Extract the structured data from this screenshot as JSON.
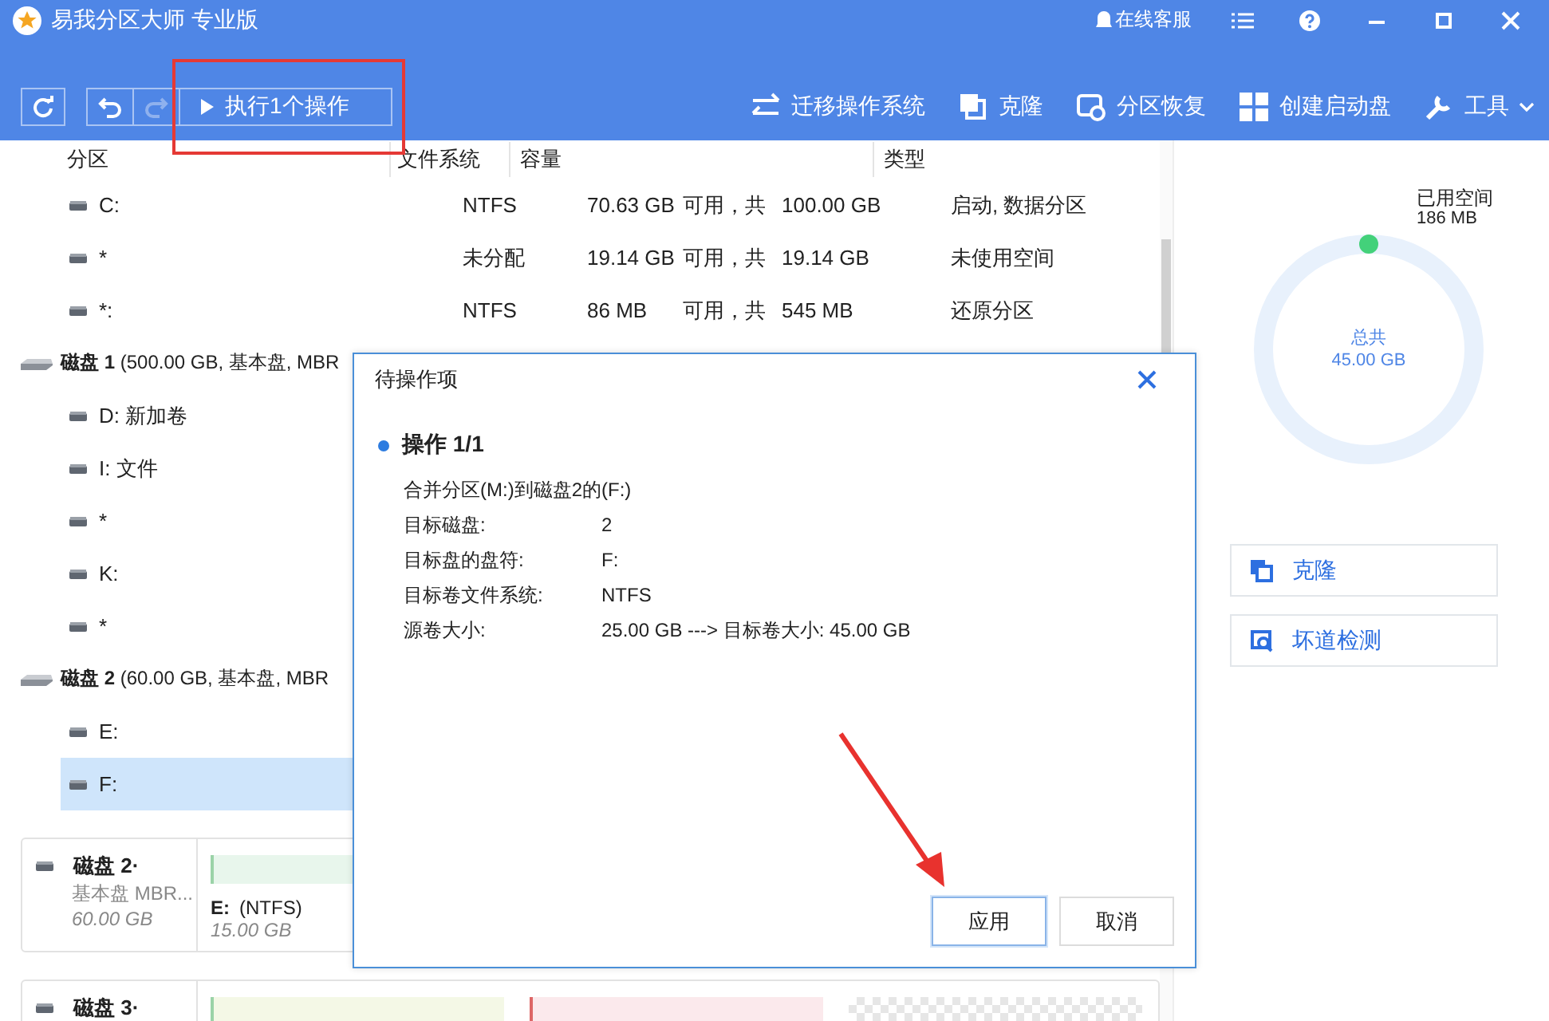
{
  "window": {
    "title": "易我分区大师 专业版",
    "support": "在线客服"
  },
  "toolbar": {
    "execute": "执行1个操作",
    "actions": [
      {
        "kind": "migrate",
        "label": "迁移操作系统"
      },
      {
        "kind": "clone",
        "label": "克隆"
      },
      {
        "kind": "recover",
        "label": "分区恢复"
      },
      {
        "kind": "boot",
        "label": "创建启动盘"
      },
      {
        "kind": "tools",
        "label": "工具",
        "dropdown": true
      }
    ]
  },
  "table": {
    "columns": [
      "分区",
      "文件系统",
      "容量",
      "类型"
    ],
    "rows": [
      {
        "kind": "partition",
        "name": "C:",
        "fs": "NTFS",
        "free": "70.63 GB",
        "mid": "可用，共",
        "total": "100.00 GB",
        "type": "启动, 数据分区",
        "selected": false
      },
      {
        "kind": "partition",
        "name": "*",
        "fs": "未分配",
        "free": "19.14 GB",
        "mid": "可用，共",
        "total": "19.14 GB",
        "type": "未使用空间",
        "selected": false
      },
      {
        "kind": "partition",
        "name": "*:",
        "fs": "NTFS",
        "free": "86 MB",
        "mid": "可用，共",
        "total": "545 MB",
        "type": "还原分区",
        "selected": false
      },
      {
        "kind": "disk",
        "title": "磁盘 1",
        "info": "(500.00 GB, 基本盘, MBR",
        "children": [
          {
            "kind": "partition",
            "name": "D: 新加卷",
            "selected": false
          },
          {
            "kind": "partition",
            "name": "I: 文件",
            "selected": false
          },
          {
            "kind": "partition",
            "name": "*",
            "selected": false
          },
          {
            "kind": "partition",
            "name": "K:",
            "selected": false
          },
          {
            "kind": "partition",
            "name": "*",
            "selected": false
          }
        ]
      },
      {
        "kind": "disk",
        "title": "磁盘 2",
        "info": "(60.00 GB, 基本盘, MBR",
        "children": [
          {
            "kind": "partition",
            "name": "E:",
            "selected": false
          },
          {
            "kind": "partition",
            "name": "F:",
            "selected": true
          }
        ]
      }
    ]
  },
  "disk_map": [
    {
      "title": "磁盘 2·",
      "style": "基本盘 MBR...",
      "size": "60.00 GB",
      "segments": [
        {
          "kind": "partition",
          "color": "#e8f6ec",
          "label": "E:",
          "fs": "(NTFS)",
          "size": "15.00 GB"
        }
      ]
    },
    {
      "title": "磁盘 3·",
      "segments": [
        {
          "kind": "partition",
          "color": "#f4f8e6"
        },
        {
          "kind": "partition",
          "color": "#fbe9ec"
        },
        {
          "kind": "unallocated"
        }
      ]
    }
  ],
  "side_panel": {
    "used_label": "已用空间",
    "used": "186 MB",
    "total_label": "总共",
    "total": "45.00 GB",
    "buttons": [
      {
        "kind": "clone",
        "label": "克隆"
      },
      {
        "kind": "scan",
        "label": "坏道检测"
      }
    ]
  },
  "dialog": {
    "title": "待操作项",
    "operation": "操作 1/1",
    "summary": "合并分区(M:)到磁盘2的(F:)",
    "details": [
      {
        "label": "目标磁盘:",
        "value": "2"
      },
      {
        "label": "目标盘的盘符:",
        "value": "F:"
      },
      {
        "label": "目标卷文件系统:",
        "value": "NTFS"
      },
      {
        "label": "源卷大小:",
        "value": "25.00 GB ---> 目标卷大小: 45.00 GB"
      }
    ],
    "buttons": [
      {
        "label": "应用",
        "selected": true
      },
      {
        "label": "取消",
        "selected": false
      }
    ]
  }
}
